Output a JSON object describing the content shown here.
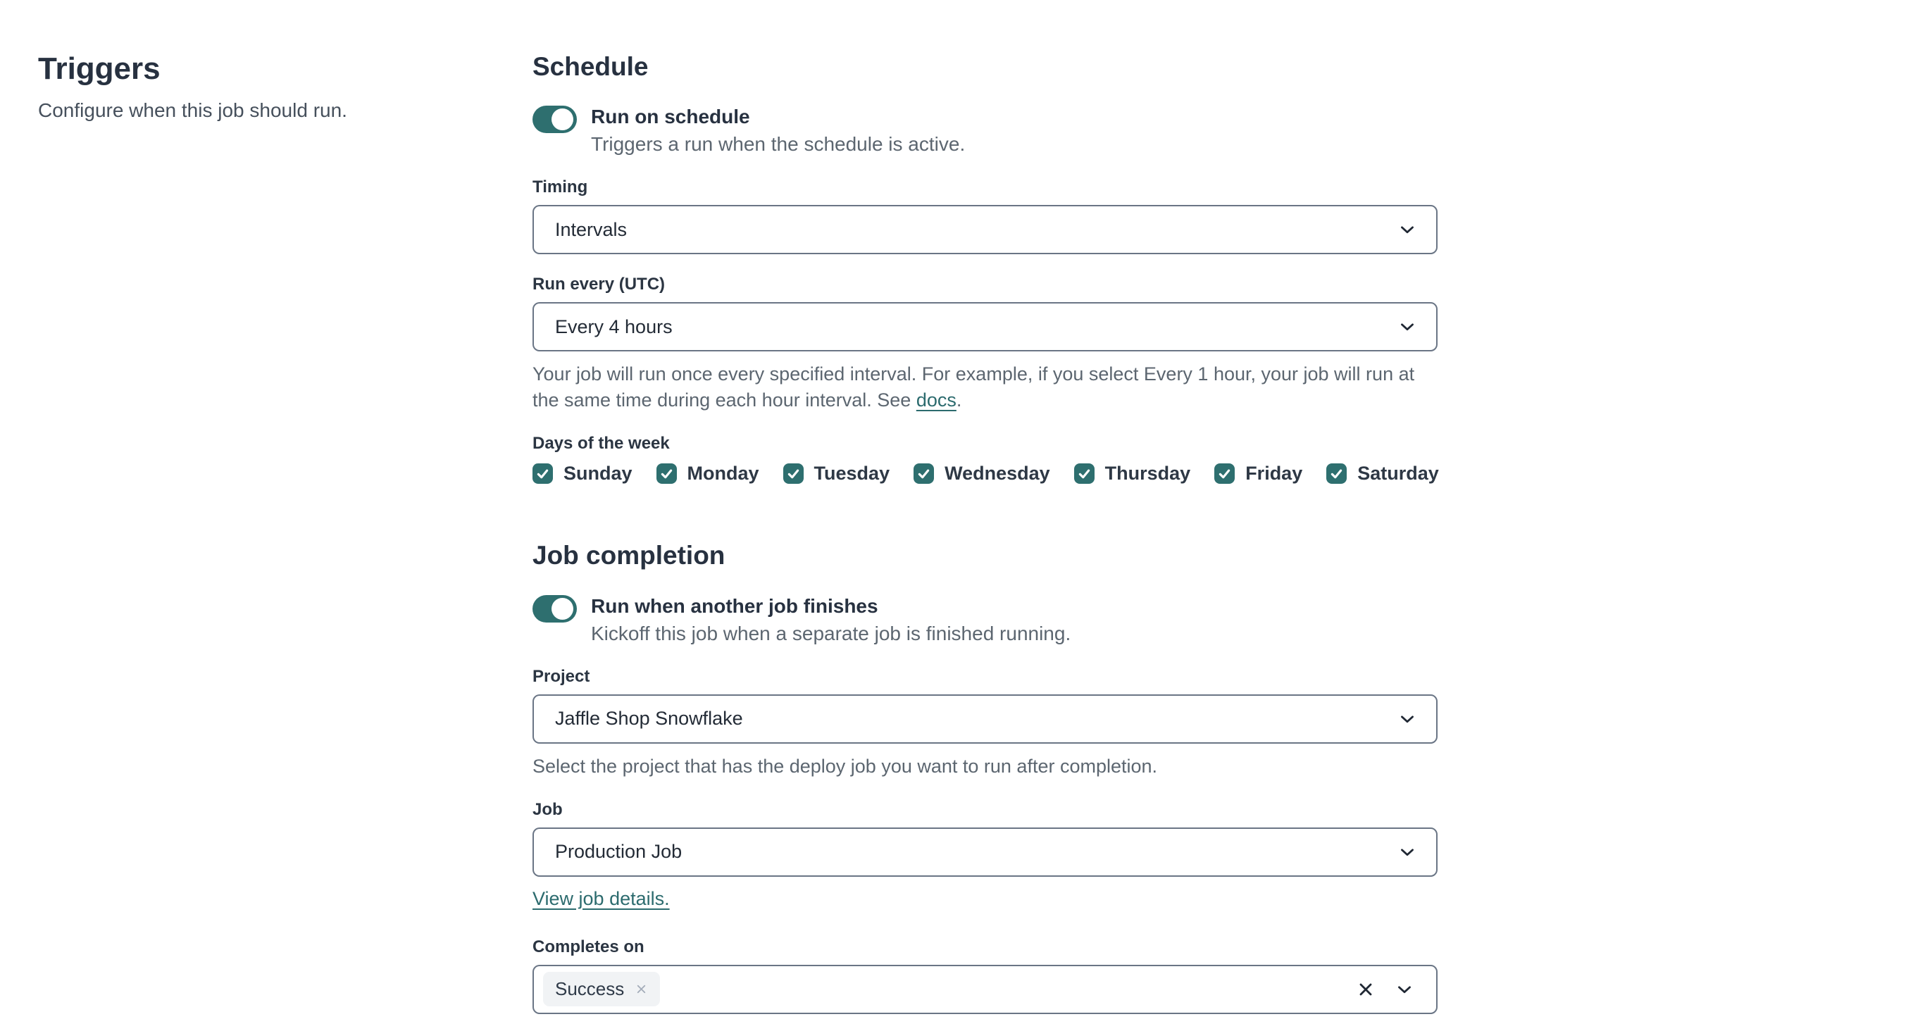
{
  "colors": {
    "accent_teal": "#2e6f6f",
    "link_teal": "#2c6b6e",
    "heading_text": "#273140",
    "muted_text": "#5c6670",
    "field_border": "#6a7585",
    "tag_background": "#f1f3f5"
  },
  "intro": {
    "title": "Triggers",
    "description": "Configure when this job should run."
  },
  "schedule": {
    "title": "Schedule",
    "toggle": {
      "label": "Run on schedule",
      "description": "Triggers a run when the schedule is active.",
      "state": "on"
    },
    "timing": {
      "label": "Timing",
      "value": "Intervals"
    },
    "run_every": {
      "label": "Run every (UTC)",
      "value": "Every 4 hours",
      "help_text": "Your job will run once every specified interval. For example, if you select Every 1 hour, your job will run at the same time during each hour interval. See ",
      "help_link_label": "docs",
      "help_suffix": "."
    },
    "days": {
      "label": "Days of the week",
      "items": [
        {
          "label": "Sunday",
          "checked": true
        },
        {
          "label": "Monday",
          "checked": true
        },
        {
          "label": "Tuesday",
          "checked": true
        },
        {
          "label": "Wednesday",
          "checked": true
        },
        {
          "label": "Thursday",
          "checked": true
        },
        {
          "label": "Friday",
          "checked": true
        },
        {
          "label": "Saturday",
          "checked": true
        }
      ]
    }
  },
  "job_completion": {
    "title": "Job completion",
    "toggle": {
      "label": "Run when another job finishes",
      "description": "Kickoff this job when a separate job is finished running.",
      "state": "on"
    },
    "project": {
      "label": "Project",
      "value": "Jaffle Shop Snowflake",
      "help": "Select the project that has the deploy job you want to run after completion."
    },
    "job": {
      "label": "Job",
      "value": "Production Job",
      "link_label": "View job details."
    },
    "completes_on": {
      "label": "Completes on",
      "tags": [
        {
          "label": "Success"
        }
      ]
    }
  }
}
